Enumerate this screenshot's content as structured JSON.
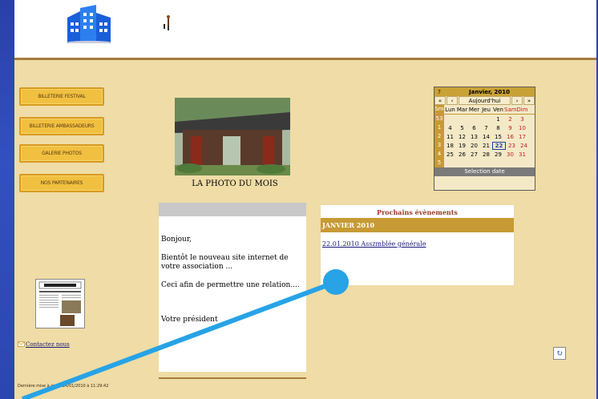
{
  "nav": {
    "buttons": [
      {
        "label": "BILLETERIE FESTIVAL"
      },
      {
        "label": "BILLETERIE AMBASSADEURS"
      },
      {
        "label": "GALERIE PHOTOS"
      },
      {
        "label": "NOS PARTENAIRES"
      }
    ]
  },
  "photo": {
    "caption": "LA PHOTO DU MOIS"
  },
  "message": {
    "greeting": "Bonjour,",
    "line1": "Bientôt le nouveau site internet de votre association ...",
    "line2": "Ceci afin de permettre une relation....",
    "signature": "Votre président"
  },
  "events": {
    "title": "Prochains évènements",
    "month": "JANVIER 2010",
    "item": "22.01.2010 Asszmblée générale"
  },
  "calendar": {
    "help": "?",
    "title": "Janvier, 2010",
    "prev_year": "«",
    "prev_month": "‹",
    "today": "Aujourd'hui",
    "next_month": "›",
    "next_year": "»",
    "week_header": "Sm",
    "day_names": [
      "Lun",
      "Mar",
      "Mer",
      "Jeu",
      "Ven",
      "Sam",
      "Dim"
    ],
    "weeks": [
      {
        "wk": "53",
        "days": [
          "",
          "",
          "",
          "",
          "1",
          "2",
          "3"
        ]
      },
      {
        "wk": "1",
        "days": [
          "4",
          "5",
          "6",
          "7",
          "8",
          "9",
          "10"
        ]
      },
      {
        "wk": "2",
        "days": [
          "11",
          "12",
          "13",
          "14",
          "15",
          "16",
          "17"
        ]
      },
      {
        "wk": "3",
        "days": [
          "18",
          "19",
          "20",
          "21",
          "22",
          "23",
          "24"
        ]
      },
      {
        "wk": "4",
        "days": [
          "25",
          "26",
          "27",
          "28",
          "29",
          "30",
          "31"
        ]
      },
      {
        "wk": "5",
        "days": [
          "",
          "",
          "",
          "",
          "",
          "",
          ""
        ]
      }
    ],
    "footer": "Selection date"
  },
  "contact": {
    "label": "Contactez nous"
  },
  "footer": {
    "text": "Dernière mise à jour : 14/01/2010 à 11:29:42"
  },
  "colors": {
    "accent": "#c79a34",
    "page_bg": "#efdca6",
    "button": "#f1c040",
    "outer": "#3350c0"
  }
}
